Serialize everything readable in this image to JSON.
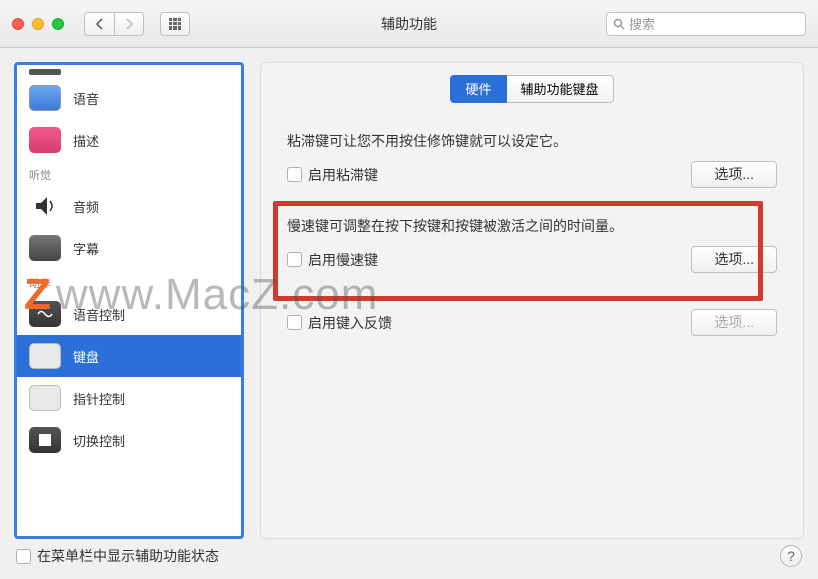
{
  "window": {
    "title": "辅助功能"
  },
  "search": {
    "placeholder": "搜索"
  },
  "sidebar": {
    "sections": [
      {
        "label": "",
        "items": [
          {
            "key": "voice",
            "label": "语音"
          },
          {
            "key": "desc",
            "label": "描述"
          }
        ]
      },
      {
        "label": "听觉",
        "items": [
          {
            "key": "audio",
            "label": "音频"
          },
          {
            "key": "subtitle",
            "label": "字幕"
          }
        ]
      },
      {
        "label": "动作",
        "items": [
          {
            "key": "voice-control",
            "label": "语音控制"
          },
          {
            "key": "keyboard",
            "label": "键盘",
            "selected": true
          },
          {
            "key": "pointer",
            "label": "指针控制"
          },
          {
            "key": "switch",
            "label": "切换控制"
          }
        ]
      }
    ]
  },
  "tabs": [
    {
      "key": "hardware",
      "label": "硬件",
      "active": true
    },
    {
      "key": "a11y-keyboard",
      "label": "辅助功能键盘"
    }
  ],
  "sticky": {
    "desc": "粘滞键可让您不用按住修饰键就可以设定它。",
    "checkbox": "启用粘滞键",
    "options": "选项..."
  },
  "slow": {
    "desc": "慢速键可调整在按下按键和按键被激活之间的时间量。",
    "checkbox": "启用慢速键",
    "options": "选项..."
  },
  "feedback": {
    "checkbox": "启用键入反馈",
    "options": "选项..."
  },
  "footer": {
    "menubar_label": "在菜单栏中显示辅助功能状态"
  },
  "watermark": {
    "z": "Z",
    "text": "www.MacZ.com"
  }
}
